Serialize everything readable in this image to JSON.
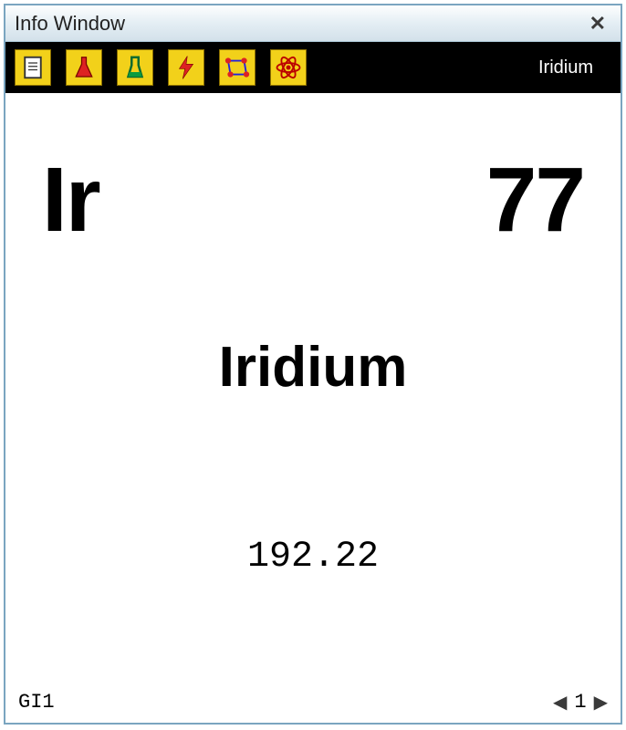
{
  "window": {
    "title": "Info Window"
  },
  "toolbar": {
    "element_label": "Iridium"
  },
  "element": {
    "symbol": "Ir",
    "atomic_number": "77",
    "name": "Iridium",
    "atomic_mass": "192.22"
  },
  "statusbar": {
    "code": "GI1",
    "page": "1"
  }
}
